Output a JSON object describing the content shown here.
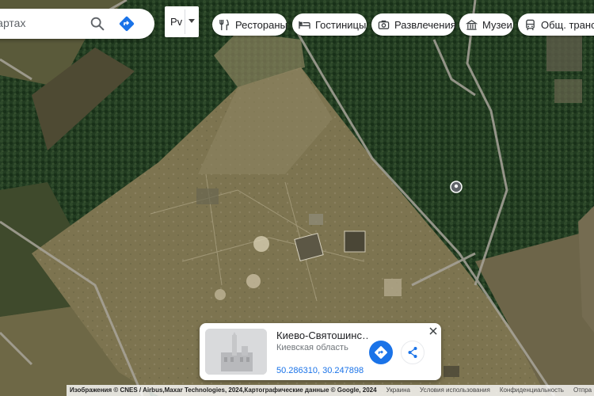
{
  "search": {
    "text": "Картах"
  },
  "lang": {
    "label": "Рv"
  },
  "chips": [
    {
      "label": "Рестораны",
      "icon": "fork-knife-icon"
    },
    {
      "label": "Гостиницы",
      "icon": "bed-icon"
    },
    {
      "label": "Развлечения",
      "icon": "camera-icon"
    },
    {
      "label": "Музеи",
      "icon": "museum-icon"
    },
    {
      "label": "Общ. трансп",
      "icon": "transit-icon"
    }
  ],
  "card": {
    "title": "Киево-Святошинс…",
    "subtitle": "Киевская область",
    "coords": "50.286310, 30.247898"
  },
  "footer": {
    "credit": "Изображения © CNES / Airbus,Maxar Technologies, 2024,Картографические данные © Google, 2024",
    "links": [
      "Украина",
      "Условия использования",
      "Конфиденциальность",
      "Отпра"
    ]
  },
  "colors": {
    "accent": "#1a73e8",
    "field": "#8a8157",
    "forest": "#1f3a1d"
  }
}
